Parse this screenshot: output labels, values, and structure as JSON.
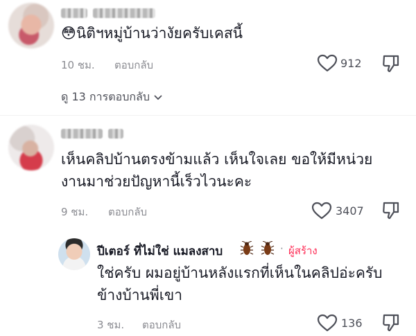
{
  "comments": [
    {
      "text": "😳นิติฯหมู่บ้านว่างัยครับเคสนี้",
      "time": "10 ชม.",
      "reply_label": "ตอบกลับ",
      "likes": "912",
      "view_replies": "ดู 13 การตอบกลับ"
    },
    {
      "text_line1": "เห็นคลิปบ้านตรงข้ามแล้ว เห็นใจเลย ขอให้มีหน่วย",
      "text_line2": "งานมาช่วยปัญหานี้เร็วไวนะคะ",
      "time": "9 ชม.",
      "reply_label": "ตอบกลับ",
      "likes": "3407"
    }
  ],
  "reply": {
    "author": "ปีเตอร์ ที่ไม่ใช่ แมลงสาบ",
    "creator_label": "ผู้สร้าง",
    "separator": "·",
    "text_line1": "ใช่ครับ ผมอยู่บ้านหลังแรกที่เห็นในคลิปอ่ะครับ",
    "text_line2": "ข้างบ้านพี่เขา",
    "time": "3 ชม.",
    "reply_label": "ตอบกลับ",
    "likes": "136"
  },
  "icons": {
    "like": "heart-outline-icon",
    "dislike": "thumbs-down-icon",
    "expand": "chevron-down-icon",
    "emoji": "cockroach-emoji"
  },
  "colors": {
    "creator_accent": "#fe2c55",
    "meta_gray": "#8a8b91"
  }
}
